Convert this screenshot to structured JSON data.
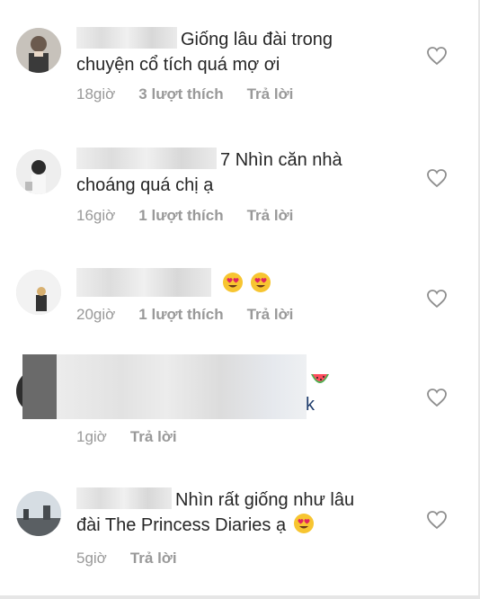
{
  "comments": [
    {
      "text": "Giống lâu đài trong chuyện cổ tích quá mợ ơi",
      "time": "18giờ",
      "likes": "3 lượt thích",
      "reply": "Trả lời"
    },
    {
      "username_visible": "7",
      "text": "Nhìn căn nhà choáng quá chị ạ",
      "time": "16giờ",
      "likes": "1 lượt thích",
      "reply": "Trả lời"
    },
    {
      "text": "",
      "emojis": [
        "heart-eyes-emoji",
        "heart-eyes-emoji"
      ],
      "time": "20giờ",
      "likes": "1 lượt thích",
      "reply": "Trả lời"
    },
    {
      "text": "k",
      "emojis": [
        "watermelon-emoji"
      ],
      "time": "1giờ",
      "reply": "Trả lời"
    },
    {
      "text": "Nhìn rất giống như lâu đài The Princess Diaries ạ",
      "emojis": [
        "heart-eyes-emoji"
      ],
      "time": "5giờ",
      "reply": "Trả lời"
    }
  ],
  "icons": {
    "like": "heart-outline-icon"
  },
  "colors": {
    "text": "#262626",
    "meta": "#999999"
  }
}
